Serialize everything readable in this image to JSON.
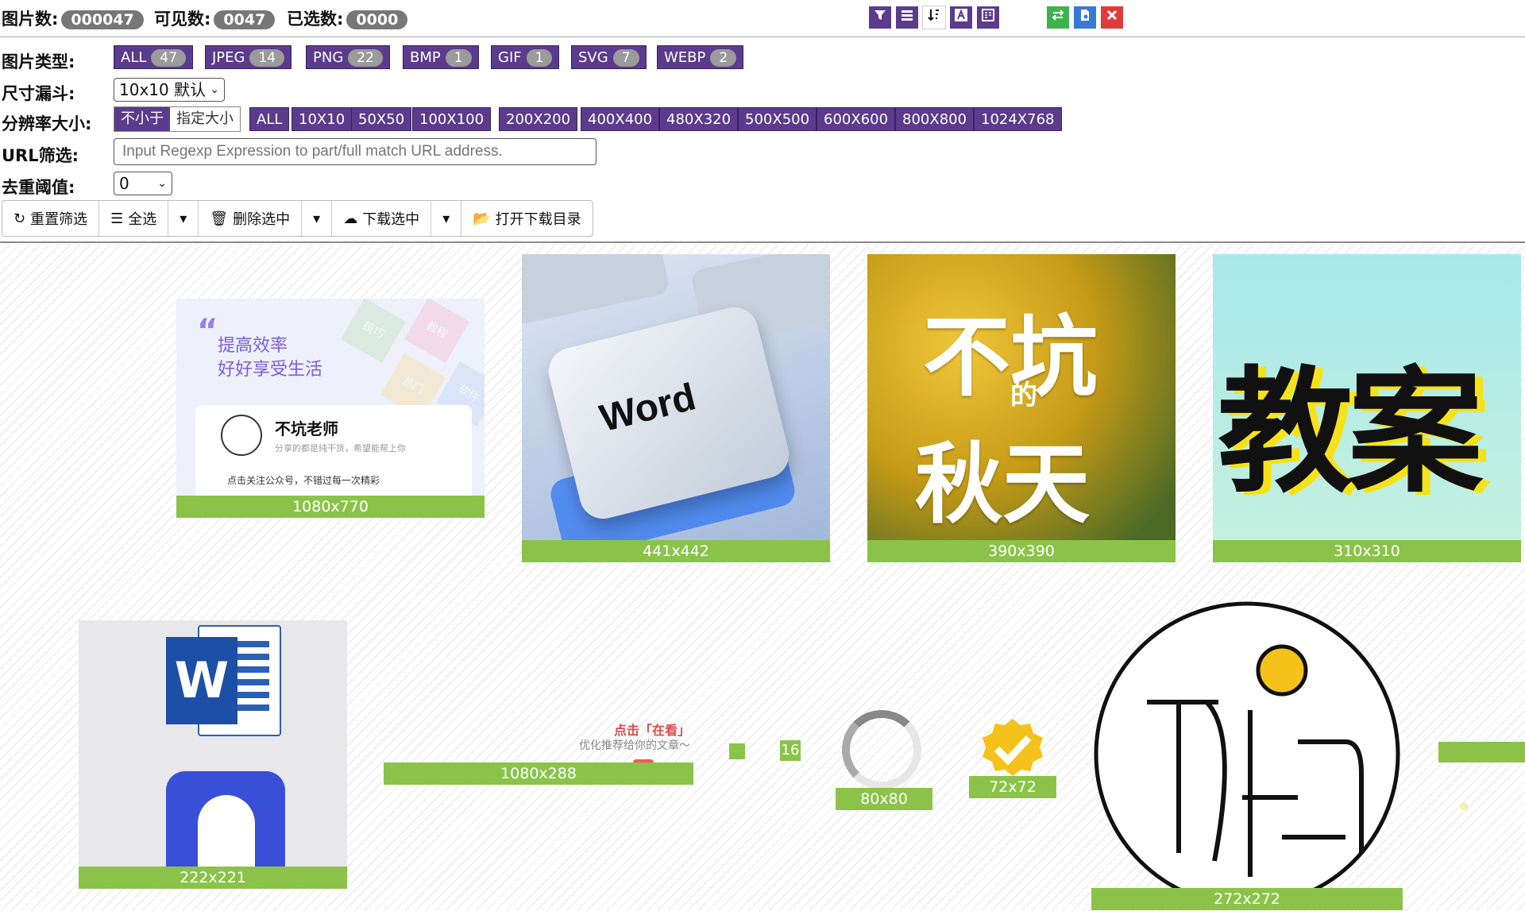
{
  "header": {
    "img_count_label": "图片数:",
    "img_count": "000047",
    "visible_label": "可见数:",
    "visible": "0047",
    "selected_label": "已选数:",
    "selected": "0000"
  },
  "filters": {
    "type_label": "图片类型:",
    "types": [
      {
        "name": "ALL",
        "count": "47"
      },
      {
        "name": "JPEG",
        "count": "14"
      },
      {
        "name": "PNG",
        "count": "22"
      },
      {
        "name": "BMP",
        "count": "1"
      },
      {
        "name": "GIF",
        "count": "1"
      },
      {
        "name": "SVG",
        "count": "7"
      },
      {
        "name": "WEBP",
        "count": "2"
      }
    ],
    "funnel_label": "尺寸漏斗:",
    "funnel_value": "10x10 默认",
    "res_label": "分辨率大小:",
    "res_mode_a": "不小于",
    "res_mode_b": "指定大小",
    "resolutions": [
      "ALL",
      "10X10",
      "50X50",
      "100X100",
      "200X200",
      "400X400",
      "480X320",
      "500X500",
      "600X600",
      "800X800",
      "1024X768"
    ],
    "url_label": "URL筛选:",
    "url_placeholder": "Input Regexp Expression to part/full match URL address.",
    "dedup_label": "去重阈值:",
    "dedup_value": "0"
  },
  "toolbar": {
    "reset": "重置筛选",
    "select_all": "全选",
    "delete": "删除选中",
    "download": "下载选中",
    "open_dir": "打开下载目录"
  },
  "images": {
    "c1": {
      "size": "1080x770",
      "t1": "提高效率",
      "t2": "好好享受生活",
      "name": "不坑老师",
      "sub": "分享的都是纯干货，希望能帮上你",
      "foot": "点击关注公众号，不错过每一次精彩",
      "blk1": "技巧",
      "blk2": "教程",
      "blk3": "热门",
      "blk4": "软件"
    },
    "c2": {
      "size": "441x442",
      "key": "Word"
    },
    "c3": {
      "size": "390x390",
      "a": "不坑",
      "b": "的",
      "c": "秋天"
    },
    "c4": {
      "size": "310x310",
      "text": "教案"
    },
    "c5": {
      "size": "222x221",
      "w": "W"
    },
    "c6": {
      "size": "1080x288",
      "t1": "点击「在看」",
      "t2": "优化推荐给你的文章～"
    },
    "c7": {
      "size": "16"
    },
    "c8": {
      "size": "80x80"
    },
    "c9": {
      "size": "72x72"
    },
    "c10": {
      "size": "272x272"
    }
  },
  "colors": {
    "purple": "#5b3b8c",
    "green": "#8bc34a",
    "red": "#e03a3a",
    "blue": "#3a78d6"
  }
}
